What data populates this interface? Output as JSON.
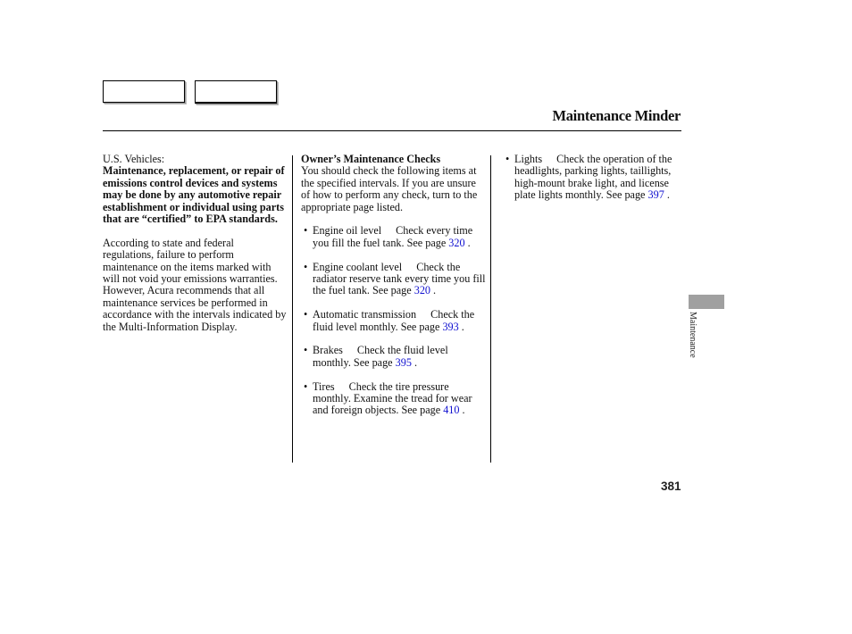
{
  "header": {
    "title": "Maintenance Minder",
    "nav_buttons": [
      "previous-page",
      "next-page"
    ]
  },
  "column1": {
    "label": "U.S. Vehicles:",
    "bold_text": "Maintenance, replacement, or repair of emissions control devices and systems may be done by any automotive repair establishment or individual using parts that are “certified” to EPA standards.",
    "para_a": "According to state and federal regulations, failure to perform maintenance on the items marked with",
    "para_b": "will not void your emissions warranties. However, Acura recommends that all maintenance services be performed in accordance with the intervals indicated by the Multi-Information Display."
  },
  "column2": {
    "heading": "Owner’s Maintenance Checks",
    "intro": "You should check the following items at the specified intervals. If you are unsure of how to perform any check, turn to the appropriate page listed.",
    "items": [
      {
        "name": "Engine oil level",
        "text": "Check every time you fill the fuel tank. See page",
        "page": "320"
      },
      {
        "name": "Engine coolant level",
        "text": "Check the radiator reserve tank every time you fill the fuel tank. See page",
        "page": "320"
      },
      {
        "name": "Automatic transmission",
        "text": "Check the fluid level monthly. See page",
        "page": "393"
      },
      {
        "name": "Brakes",
        "text": "Check the fluid level monthly. See page",
        "page": "395"
      },
      {
        "name": "Tires",
        "text": "Check the tire pressure monthly. Examine the tread for wear and foreign objects. See page",
        "page": "410"
      }
    ]
  },
  "column3": {
    "items": [
      {
        "name": "Lights",
        "text": "Check the operation of the headlights, parking lights, taillights, high-mount brake light, and license plate lights monthly. See page",
        "page": "397"
      }
    ]
  },
  "side_tab": {
    "label": "Maintenance"
  },
  "footer": {
    "page_number": "381"
  },
  "colors": {
    "link": "#1010d0",
    "tab": "#a0a0a0"
  }
}
